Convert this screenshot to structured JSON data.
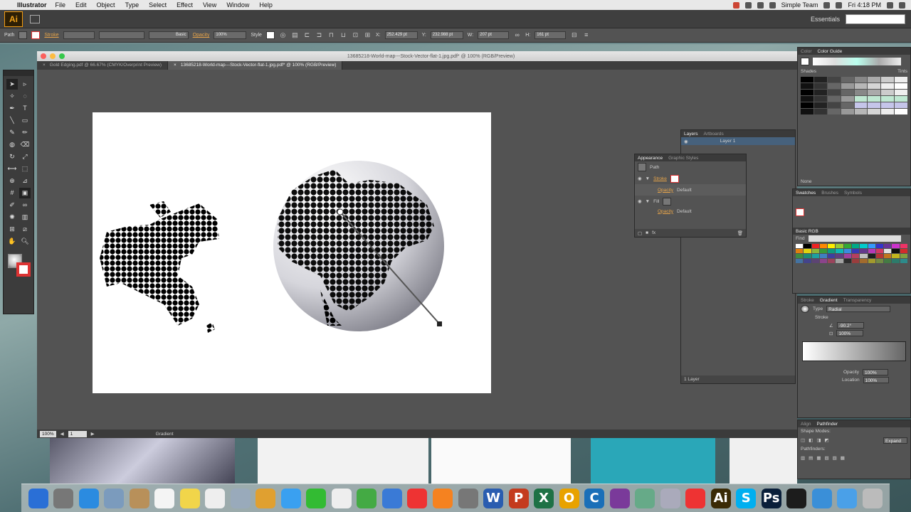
{
  "menubar": {
    "app_name": "Illustrator",
    "items": [
      "File",
      "Edit",
      "Object",
      "Type",
      "Select",
      "Effect",
      "View",
      "Window",
      "Help"
    ],
    "user": "Simple Team",
    "clock": "Fri 4:18 PM"
  },
  "appbar": {
    "logo": "Ai",
    "workspace": "Essentials"
  },
  "controlbar": {
    "selection_type": "Path",
    "stroke_label": "Stroke",
    "stroke_style": "Basic",
    "opacity_label": "Opacity",
    "opacity_value": "100%",
    "style_label": "Style",
    "x_value": "252.429 pt",
    "y_value": "232.988 pt",
    "w_value": "207 pt",
    "h_value": "161 pt"
  },
  "document": {
    "window_title": "13685218-World-map---Stock-Vector-flat-1.jpg.pdf* @ 100% (RGB/Preview)",
    "tabs": [
      {
        "label": "Gold Edging.pdf @ 66.67% (CMYK/Overprint Preview)",
        "active": false
      },
      {
        "label": "13685218-World-map---Stock-Vector-flat-1.jpg.pdf* @ 100% (RGB/Preview)",
        "active": true
      }
    ],
    "zoom": "100%",
    "artboard_nav": "1",
    "status_tool": "Gradient"
  },
  "panels": {
    "color": {
      "tabs": [
        "Color",
        "Color Guide"
      ],
      "shades_label": "Shades",
      "tints_label": "Tints",
      "none_label": "None"
    },
    "swatches": {
      "tabs": [
        "Swatches",
        "Brushes",
        "Symbols"
      ]
    },
    "library": {
      "title": "Basic RGB",
      "find_label": "Find"
    },
    "gradient": {
      "tabs": [
        "Stroke",
        "Gradient",
        "Transparency"
      ],
      "type_label": "Type",
      "type_value": "Radial",
      "stroke_label": "Stroke",
      "angle_value": "-90.2°",
      "aspect_value": "100%",
      "opacity_label": "Opacity",
      "opacity_value": "100%",
      "location_label": "Location",
      "location_value": "100%"
    },
    "pathfinder": {
      "tabs": [
        "Align",
        "Pathfinder"
      ],
      "shape_modes_label": "Shape Modes:",
      "pathfinders_label": "Pathfinders:",
      "expand_label": "Expand"
    },
    "layers": {
      "tabs": [
        "Layers",
        "Artboards"
      ],
      "layer_name": "Layer 1",
      "footer": "1 Layer"
    },
    "appearance": {
      "tabs": [
        "Appearance",
        "Graphic Styles"
      ],
      "object": "Path",
      "stroke_label": "Stroke",
      "opacity_label": "Opacity",
      "opacity_value": "Default",
      "fill_label": "Fill"
    }
  },
  "dock": {
    "icons": [
      "finder-icon",
      "launchpad-icon",
      "safari-icon",
      "mail-icon",
      "contacts-icon",
      "calendar-icon",
      "notes-icon",
      "reminders-icon",
      "preview-icon",
      "photos-icon",
      "messages-icon",
      "facetime-icon",
      "textedit-icon",
      "numbers-icon",
      "keynote-icon",
      "itunes-icon",
      "ibooks-icon",
      "system-preferences-icon",
      "word-icon",
      "powerpoint-icon",
      "excel-icon",
      "outlook-icon",
      "citrix-icon",
      "onenote-icon",
      "xquartz-icon",
      "image-capture-icon",
      "chrome-icon",
      "illustrator-icon",
      "skype-icon",
      "photoshop-icon",
      "terminal-icon",
      "downloads-icon",
      "folder-icon",
      "trash-icon"
    ],
    "labels": [
      "",
      "",
      "",
      "",
      "",
      "",
      "",
      "",
      "",
      "",
      "",
      "",
      "",
      "",
      "",
      "",
      "",
      "",
      "W",
      "P",
      "X",
      "O",
      "C",
      "",
      "",
      "",
      "",
      "Ai",
      "S",
      "Ps",
      "",
      "",
      "",
      ""
    ],
    "colors": [
      "#2a6fd6",
      "#777",
      "#2b8be0",
      "#7b9bbd",
      "#b8905a",
      "#f4f4f4",
      "#f1d54a",
      "#eee",
      "#9ab",
      "#e0a030",
      "#3aa0f0",
      "#3b3",
      "#eee",
      "#4a4",
      "#3a7ad6",
      "#e33",
      "#f58220",
      "#777",
      "#2a5db0",
      "#c43b1e",
      "#1e7145",
      "#e8a200",
      "#1a6fb8",
      "#7a3a9a",
      "#6a8",
      "#aab",
      "#e33",
      "#3a2a05",
      "#00aff0",
      "#0a1f3a",
      "#1c1c1c",
      "#3a8fd8",
      "#4aa0e8",
      "#bbb"
    ]
  }
}
